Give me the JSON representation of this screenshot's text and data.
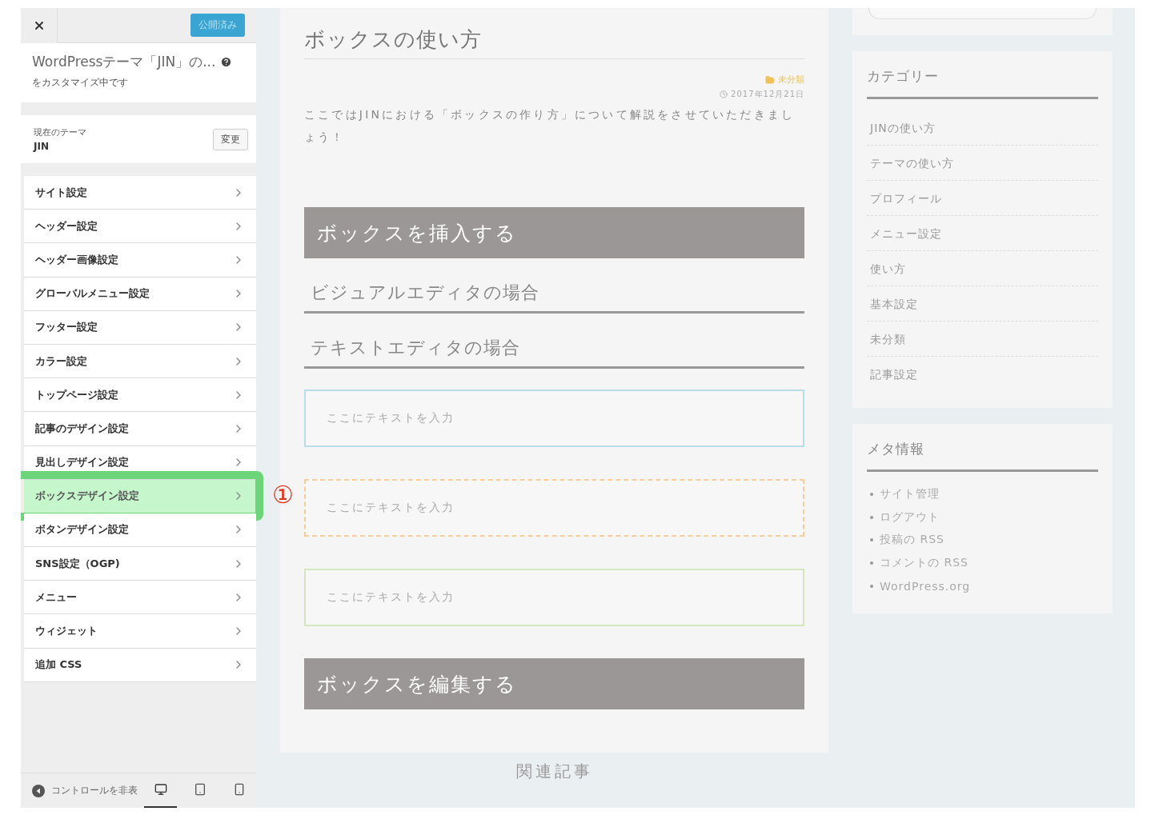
{
  "customizer": {
    "publish_button": "公開済み",
    "title": "WordPressテーマ「JIN」の...",
    "subtitle": "をカスタマイズ中です",
    "theme": {
      "label": "現在のテーマ",
      "name": "JIN",
      "change_button": "変更"
    },
    "menu": [
      {
        "label": "サイト設定",
        "selected": false
      },
      {
        "label": "ヘッダー設定",
        "selected": false
      },
      {
        "label": "ヘッダー画像設定",
        "selected": false
      },
      {
        "label": "グローバルメニュー設定",
        "selected": false
      },
      {
        "label": "フッター設定",
        "selected": false
      },
      {
        "label": "カラー設定",
        "selected": false
      },
      {
        "label": "トップページ設定",
        "selected": false
      },
      {
        "label": "記事のデザイン設定",
        "selected": false
      },
      {
        "label": "見出しデザイン設定",
        "selected": false
      },
      {
        "label": "ボックスデザイン設定",
        "selected": true
      },
      {
        "label": "ボタンデザイン設定",
        "selected": false
      },
      {
        "label": "SNS設定（OGP)",
        "selected": false
      },
      {
        "label": "メニュー",
        "selected": false
      },
      {
        "label": "ウィジェット",
        "selected": false
      },
      {
        "label": "追加 CSS",
        "selected": false
      }
    ],
    "footer": {
      "hide_controls": "コントロールを非表",
      "devices": [
        {
          "kind": "desktop",
          "selected": true
        },
        {
          "kind": "tablet",
          "selected": false
        },
        {
          "kind": "mobile",
          "selected": false
        }
      ]
    }
  },
  "annotation": {
    "marker": "①"
  },
  "article": {
    "title": "ボックスの使い方",
    "category": "未分類",
    "date": "2017年12月21日",
    "intro": "ここではJINにおける「ボックスの作り方」について解説をさせていただきましょう！",
    "blocks": [
      {
        "kind": "banner",
        "text": "ボックスを挿入する"
      },
      {
        "kind": "heading",
        "text": "ビジュアルエディタの場合"
      },
      {
        "kind": "heading",
        "text": "テキストエディタの場合"
      },
      {
        "kind": "box",
        "color": "#b9dce8",
        "text": "ここにテキストを入力"
      },
      {
        "kind": "dashed_box",
        "color": "#f7cc9c",
        "text": "ここにテキストを入力"
      },
      {
        "kind": "box",
        "color": "#d3e6bd",
        "text": "ここにテキストを入力"
      },
      {
        "kind": "banner",
        "text": "ボックスを編集する"
      }
    ]
  },
  "related_heading": "関連記事",
  "widgets": {
    "categories": {
      "title": "カテゴリー",
      "items": [
        "JINの使い方",
        "テーマの使い方",
        "プロフィール",
        "メニュー設定",
        "使い方",
        "基本設定",
        "未分類",
        "記事設定"
      ]
    },
    "meta": {
      "title": "メタ情報",
      "items": [
        "サイト管理",
        "ログアウト",
        "投稿の RSS",
        "コメントの RSS",
        "WordPress.org"
      ]
    }
  }
}
